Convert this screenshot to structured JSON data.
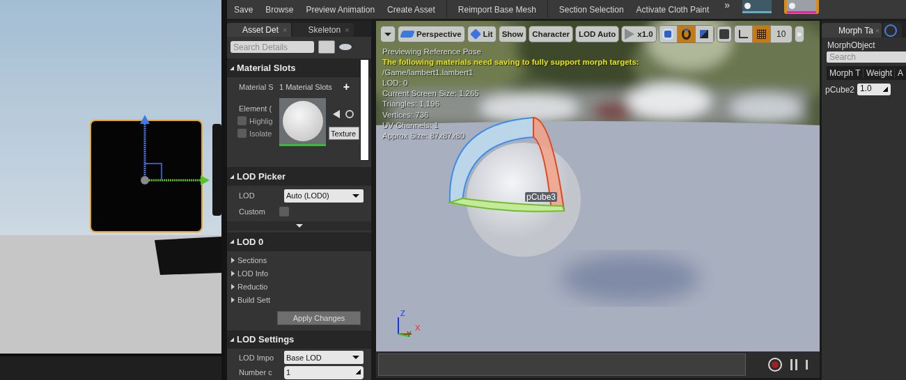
{
  "toolbar": {
    "buttons": [
      {
        "label": "Save"
      },
      {
        "label": "Browse"
      },
      {
        "label": "Preview Animation"
      },
      {
        "label": "Create Asset"
      },
      {
        "label": "Reimport Base Mesh"
      },
      {
        "label": "Section Selection"
      },
      {
        "label": "Activate Cloth Paint"
      }
    ],
    "overflow": "»",
    "thumbnails": [
      {
        "selected": false
      },
      {
        "selected": true
      }
    ]
  },
  "details": {
    "tabs": [
      {
        "label": "Asset Det",
        "close": "×",
        "selected": true
      },
      {
        "label": "Skeleton",
        "close": "×",
        "selected": false
      }
    ],
    "search": {
      "placeholder": "Search Details"
    },
    "material_slots": {
      "title": "Material Slots",
      "expanded": true,
      "slots_label": "Material S",
      "slots_value": "1 Material Slots",
      "add": "+",
      "element_label": "Element (",
      "highlight": {
        "label": "Highlig",
        "checked": false
      },
      "isolate": {
        "label": "Isolate",
        "checked": false
      },
      "texture_button": "Texture"
    },
    "lod_picker": {
      "title": "LOD Picker",
      "expanded": true,
      "lod_label": "LOD",
      "lod_value": "Auto (LOD0)",
      "custom": {
        "label": "Custom",
        "checked": false
      }
    },
    "lod0": {
      "title": "LOD 0",
      "expanded": true,
      "groups": [
        {
          "label": "Sections",
          "expanded": false
        },
        {
          "label": "LOD Info",
          "expanded": false
        },
        {
          "label": "Reductio",
          "expanded": false
        },
        {
          "label": "Build Sett",
          "expanded": false
        }
      ],
      "apply_button": "Apply Changes"
    },
    "lod_settings": {
      "title": "LOD Settings",
      "expanded": true,
      "import_label": "LOD Impo",
      "import_value": "Base LOD",
      "number_label": "Number c",
      "number_value": "1"
    }
  },
  "viewport": {
    "toolbar": [
      {
        "kind": "menu"
      },
      {
        "kind": "perspective",
        "label": "Perspective"
      },
      {
        "kind": "lit",
        "label": "Lit"
      },
      {
        "kind": "plain",
        "label": "Show"
      },
      {
        "kind": "plain",
        "label": "Character"
      },
      {
        "kind": "plain",
        "label": "LOD Auto"
      },
      {
        "kind": "speed",
        "label": "x1.0"
      },
      {
        "kind": "transform",
        "tools": [
          {
            "selected": false
          },
          {
            "selected": true
          },
          {
            "selected": false
          }
        ]
      },
      {
        "kind": "surface"
      },
      {
        "kind": "grid",
        "tools": [
          {
            "selected": false
          },
          {
            "selected": true
          }
        ],
        "value": "10"
      },
      {
        "kind": "overflow",
        "label": "»"
      }
    ],
    "overlay_lines": [
      {
        "text": "Previewing Reference Pose",
        "kind": "info"
      },
      {
        "text": "The following materials need saving to fully support morph targets:",
        "kind": "warning"
      },
      {
        "text": "/Game/lambert1.lambert1",
        "kind": "info"
      },
      {
        "text": "LOD: 0",
        "kind": "info"
      },
      {
        "text": "Current Screen Size: 1.265",
        "kind": "info"
      },
      {
        "text": "Triangles: 1,196",
        "kind": "info"
      },
      {
        "text": "Vertices: 736",
        "kind": "info"
      },
      {
        "text": "UV Channels: 1",
        "kind": "info"
      },
      {
        "text": "Approx Size: 87x87x80",
        "kind": "info"
      }
    ],
    "object_label": "pCube3",
    "axes": {
      "z": "Z",
      "x": "X",
      "y": "Y"
    }
  },
  "playback": {
    "recording": false
  },
  "morph_panel": {
    "tabs": [
      {
        "label": "Morph Ta",
        "close": "×",
        "selected": true
      },
      {
        "selected": false
      }
    ],
    "object_label": "MorphObject",
    "search": {
      "placeholder": "Search"
    },
    "columns": [
      "Morph T",
      "Weight",
      "A"
    ],
    "rows": [
      {
        "name": "pCube2",
        "weight": "1.0"
      }
    ]
  }
}
